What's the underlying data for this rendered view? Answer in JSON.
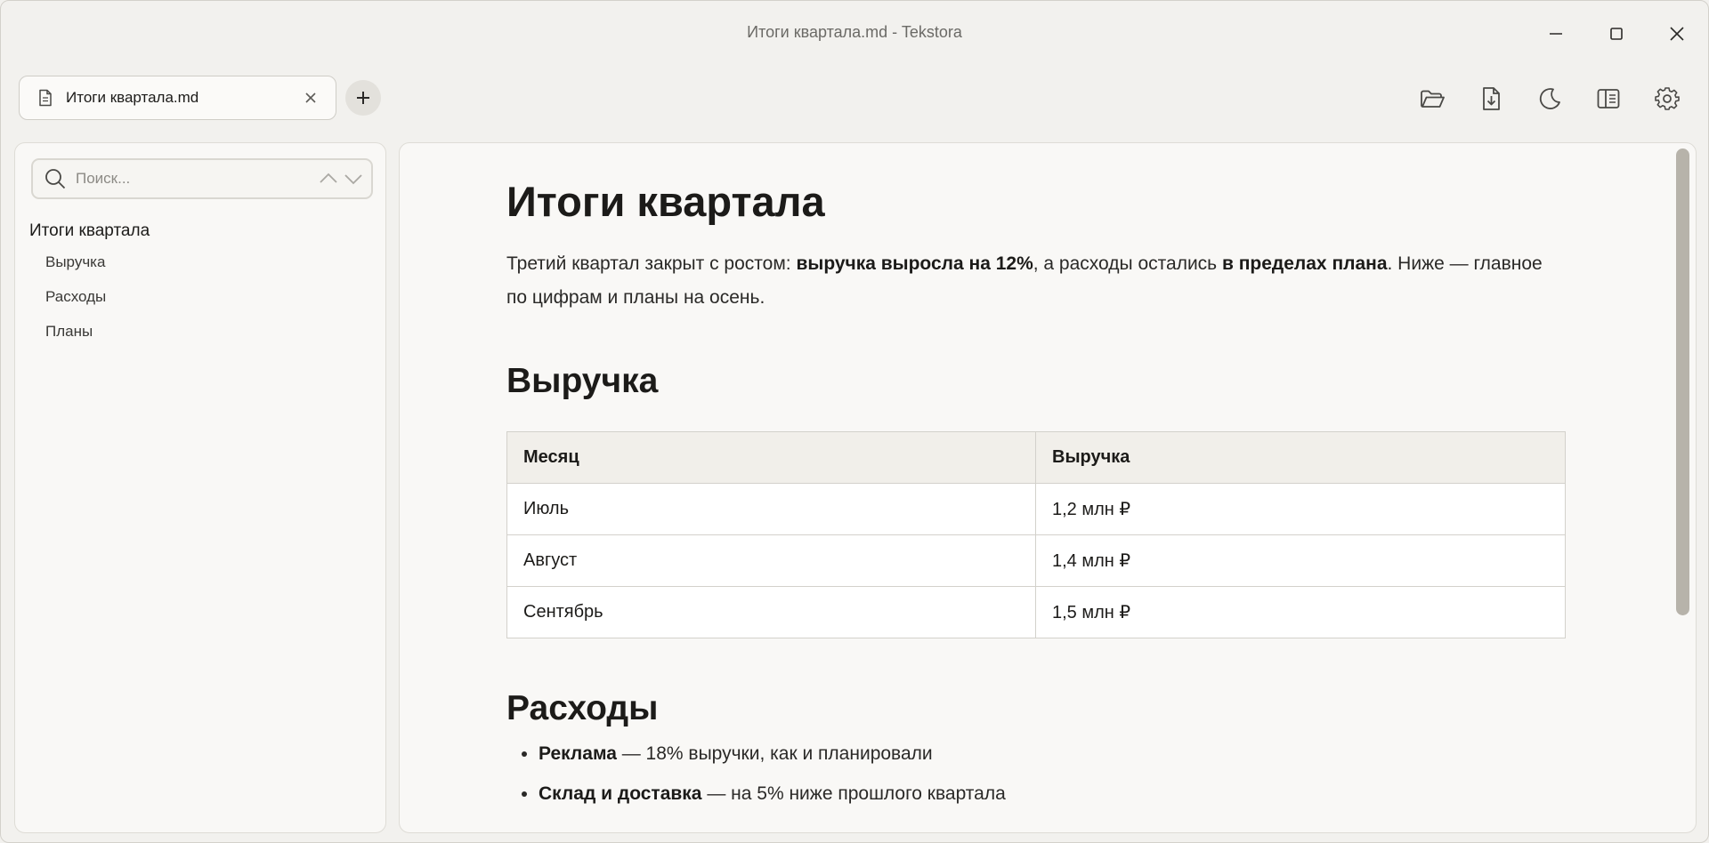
{
  "window": {
    "title": "Итоги квартала.md - Tekstora"
  },
  "tabs": [
    {
      "label": "Итоги квартала.md",
      "active": true
    }
  ],
  "toolbar": {
    "icons": [
      "folder-open-icon",
      "download-icon",
      "moon-icon",
      "sidebar-toggle-icon",
      "gear-icon"
    ]
  },
  "search": {
    "placeholder": "Поиск...",
    "value": ""
  },
  "outline": {
    "title": "Итоги квартала",
    "items": [
      "Выручка",
      "Расходы",
      "Планы"
    ]
  },
  "document": {
    "title": "Итоги квартала",
    "lead": {
      "part1": "Третий квартал закрыт с ростом: ",
      "bold1": "выручка выросла на 12%",
      "part2": ", а расходы остались ",
      "bold2": "в пределах плана",
      "part3": ". Ниже — главное по цифрам и планы на осень."
    },
    "section_revenue": "Выручка",
    "table": {
      "headers": [
        "Месяц",
        "Выручка"
      ],
      "rows": [
        [
          "Июль",
          "1,2 млн ₽"
        ],
        [
          "Август",
          "1,4 млн ₽"
        ],
        [
          "Сентябрь",
          "1,5 млн ₽"
        ]
      ]
    },
    "section_expenses": "Расходы",
    "expenses": [
      {
        "bold": "Реклама",
        "text": " — 18% выручки, как и планировали"
      },
      {
        "bold": "Склад и доставка",
        "text": " — на 5% ниже прошлого квартала"
      }
    ]
  },
  "colors": {
    "background": "#f2f1ee",
    "panel": "#f9f8f6",
    "scrollbar": "#b7b3aa"
  }
}
